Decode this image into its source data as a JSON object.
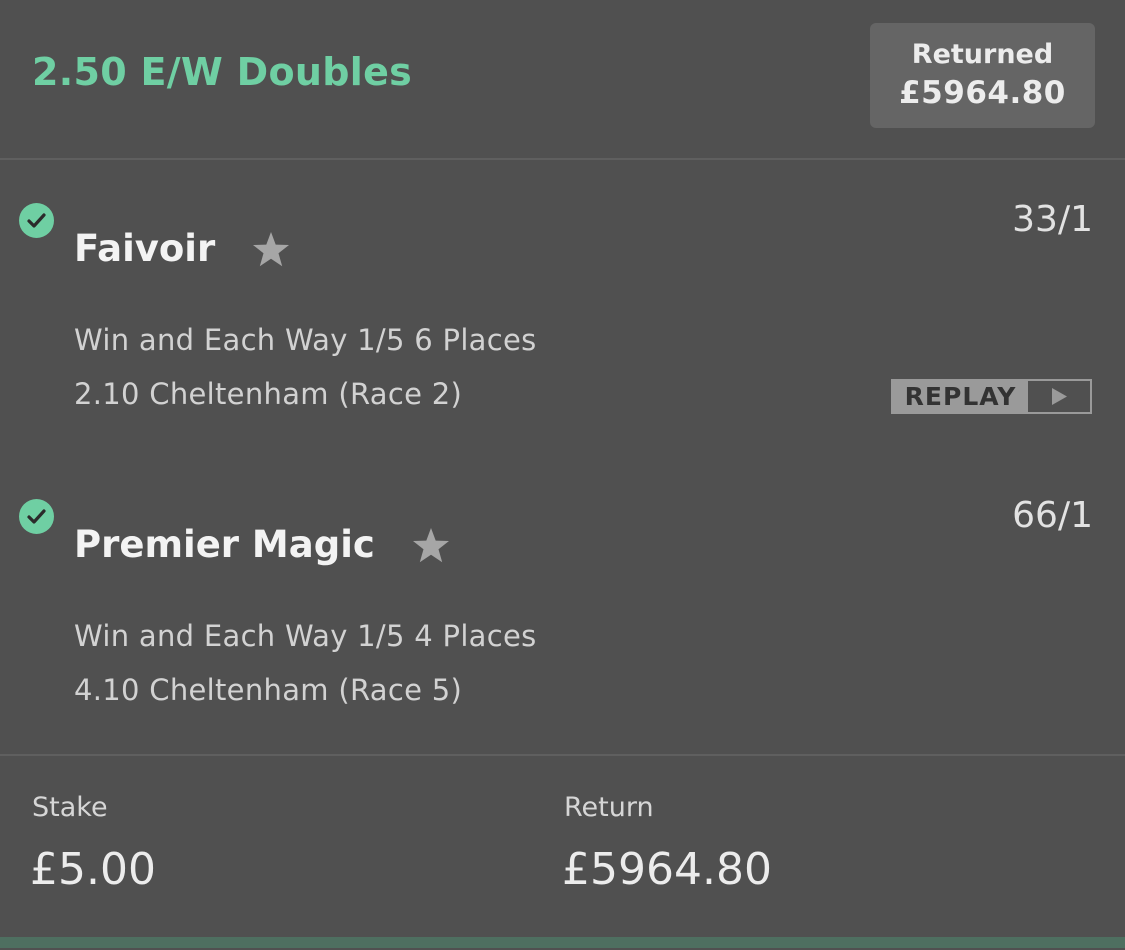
{
  "bet": {
    "title": "2.50 E/W Doubles",
    "returned_label": "Returned",
    "returned_value": "£5964.80"
  },
  "selections": [
    {
      "status": "won",
      "name": "Faivoir",
      "odds": "33/1",
      "market": "Win and Each Way 1/5 6 Places",
      "race": "2.10 Cheltenham (Race 2)",
      "replay_label": "REPLAY",
      "icons": [
        "check-icon",
        "star-icon",
        "play-icon"
      ]
    },
    {
      "status": "won",
      "name": "Premier Magic",
      "odds": "66/1",
      "market": "Win and Each Way 1/5 4 Places",
      "race": "4.10 Cheltenham (Race 5)",
      "icons": [
        "check-icon",
        "star-icon"
      ]
    }
  ],
  "summary": {
    "stake_label": "Stake",
    "stake_value": "£5.00",
    "return_label": "Return",
    "return_value": "£5964.80"
  },
  "colors": {
    "background": "#505050",
    "accent_green": "#6fcfa3",
    "returned_box": "#656565"
  }
}
